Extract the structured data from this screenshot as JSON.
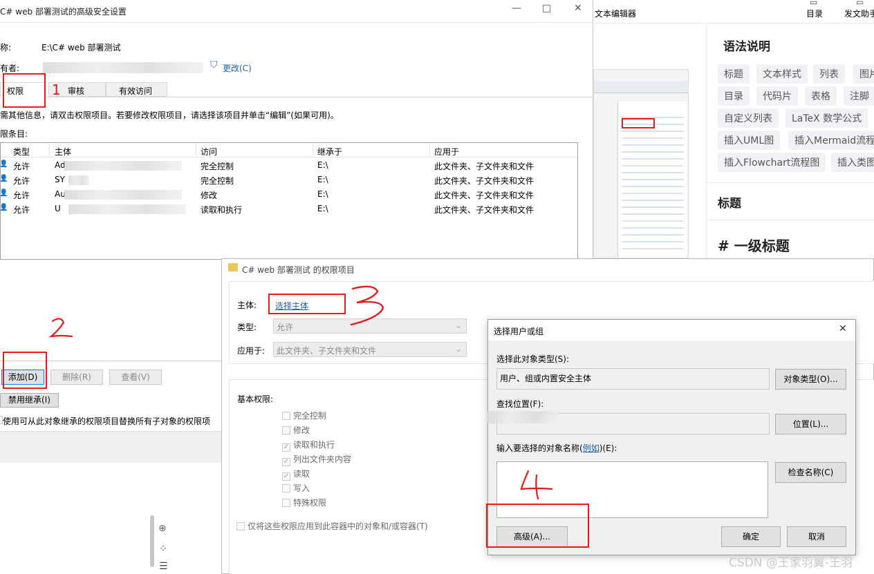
{
  "adv_dialog": {
    "title": "C# web 部署测试的高级安全设置",
    "name_label": "称:",
    "name_value": "E:\\C# web 部署测试",
    "owner_label": "有者:",
    "owner_change": "更改(C)",
    "tabs": [
      "权限",
      "审核",
      "有效访问"
    ],
    "info_text": "需其他信息，请双击权限项目。若要修改权限项目，请选择该项目并单击“编辑”(如果可用)。",
    "entries_label": "限条目:",
    "columns": [
      "类型",
      "主体",
      "访问",
      "继承于",
      "应用于"
    ],
    "rows": [
      {
        "type": "允许",
        "principal": "Ad",
        "access": "完全控制",
        "inherited": "E:\\",
        "applies": "此文件夹、子文件夹和文件"
      },
      {
        "type": "允许",
        "principal": "SY",
        "access": "完全控制",
        "inherited": "E:\\",
        "applies": "此文件夹、子文件夹和文件"
      },
      {
        "type": "允许",
        "principal": "Au",
        "access": "修改",
        "inherited": "E:\\",
        "applies": "此文件夹、子文件夹和文件"
      },
      {
        "type": "允许",
        "principal": "U",
        "access": "读取和执行",
        "inherited": "E:\\",
        "applies": "此文件夹、子文件夹和文件"
      }
    ],
    "btn_add": "添加(D)",
    "btn_remove": "删除(R)",
    "btn_view": "查看(V)",
    "btn_disable_inherit": "禁用继承(I)",
    "replace_text": "使用可从此对象继承的权限项目替换所有子对象的权限项"
  },
  "entry_dialog": {
    "title": "C# web 部署测试 的权限项目",
    "principal_label": "主体:",
    "principal_link": "选择主体",
    "type_label": "类型:",
    "type_value": "允许",
    "applies_label": "应用于:",
    "applies_value": "此文件夹、子文件夹和文件",
    "basic_label": "基本权限:",
    "perms": [
      {
        "label": "完全控制",
        "checked": false
      },
      {
        "label": "修改",
        "checked": false
      },
      {
        "label": "读取和执行",
        "checked": true
      },
      {
        "label": "列出文件夹内容",
        "checked": true
      },
      {
        "label": "读取",
        "checked": true
      },
      {
        "label": "写入",
        "checked": false
      },
      {
        "label": "特殊权限",
        "checked": false
      }
    ],
    "only_apply": "仅将这些权限应用到此容器中的对象和/或容器(T)"
  },
  "select_dialog": {
    "title": "选择用户或组",
    "obj_type_label": "选择此对象类型(S):",
    "obj_type_value": "用户、组或内置安全主体",
    "obj_type_btn": "对象类型(O)...",
    "location_label": "查找位置(F):",
    "location_btn": "位置(L)...",
    "enter_label_pre": "输入要选择的对象名称(",
    "enter_label_link": "例如",
    "enter_label_post": ")(E):",
    "check_btn": "检查名称(C)",
    "advanced_btn": "高级(A)...",
    "ok_btn": "确定",
    "cancel_btn": "取消"
  },
  "editor": {
    "toolbar_left": "文本编辑器",
    "toolbar_toc": "目录",
    "toolbar_assist": "发文助手",
    "syntax_title": "语法说明",
    "tags": [
      "标题",
      "文本样式",
      "列表",
      "图片",
      "目录",
      "代码片",
      "表格",
      "注脚",
      "自定义列表",
      "LaTeX 数学公式",
      "插入UML图",
      "插入Mermaid流程",
      "插入Flowchart流程图",
      "插入类图"
    ],
    "section_heading": "标题",
    "h1_example": "# 一级标题"
  },
  "annotations": [
    "1",
    "2",
    "3",
    "4"
  ],
  "watermark": "CSDN @王家羽翼-王羽",
  "colors": {
    "annotation": "#e31b1b",
    "link": "#1a5fb4",
    "tag_bg": "#f0f2f5"
  }
}
